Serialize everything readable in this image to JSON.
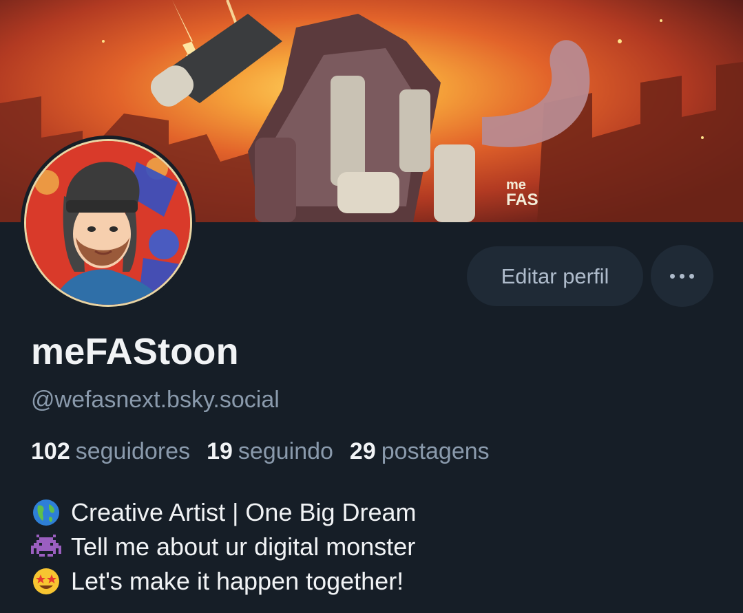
{
  "banner": {
    "watermark_line1": "me",
    "watermark_line2": "FAS"
  },
  "profile": {
    "display_name": "meFAStoon",
    "handle": "@wefasnext.bsky.social"
  },
  "actions": {
    "edit_label": "Editar perfil",
    "more_icon": "ellipsis-icon"
  },
  "stats": [
    {
      "count": "102",
      "label": "seguidores"
    },
    {
      "count": "19",
      "label": "seguindo"
    },
    {
      "count": "29",
      "label": "postagens"
    }
  ],
  "bio": [
    {
      "emoji": "globe-americas-icon",
      "text": "Creative Artist | One Big Dream"
    },
    {
      "emoji": "alien-monster-icon",
      "text": "Tell me about ur digital monster"
    },
    {
      "emoji": "star-struck-face-icon",
      "text": "Let's make it happen together!"
    }
  ],
  "colors": {
    "background": "#161e27",
    "button_bg": "#1f2a36",
    "text_primary": "#f1f3f5",
    "text_secondary": "#8a9aac"
  }
}
